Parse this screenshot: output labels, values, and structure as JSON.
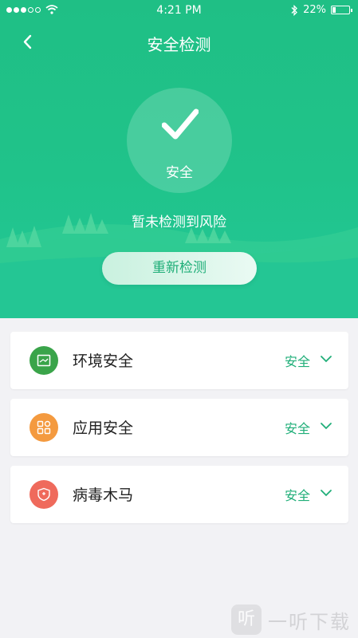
{
  "status_bar": {
    "time": "4:21 PM",
    "battery_text": "22%",
    "battery_level": 0.22,
    "signal_bars_filled": 3,
    "signal_bars_total": 5
  },
  "nav": {
    "title": "安全检测"
  },
  "result": {
    "badge_label": "安全",
    "message": "暂未检测到风险"
  },
  "actions": {
    "rescan_label": "重新检测"
  },
  "checks": [
    {
      "label": "环境安全",
      "status": "安全",
      "icon": "environment-icon",
      "color": "#3aa44a"
    },
    {
      "label": "应用安全",
      "status": "安全",
      "icon": "apps-grid-icon",
      "color": "#f49a3f"
    },
    {
      "label": "病毒木马",
      "status": "安全",
      "icon": "virus-shield-icon",
      "color": "#ef6a5c"
    }
  ],
  "watermark": {
    "logo_glyph": "听",
    "text": "一听下载"
  },
  "colors": {
    "primary": "#1fbf85",
    "safe_text": "#1fae78"
  }
}
